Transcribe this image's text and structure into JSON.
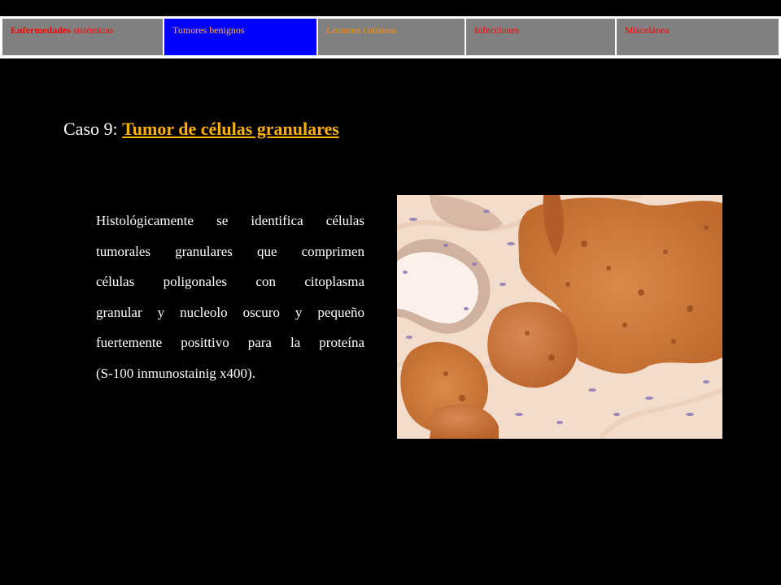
{
  "colors": {
    "background": "#000000",
    "nav_border": "#ffffff",
    "nav_cell_bg": "#808080",
    "nav_cell_active_bg": "#0000ff",
    "nav_text_red": "#ff0000",
    "nav_text_orange": "#ffb347",
    "title_text": "#ffffff",
    "title_link": "#ffb000",
    "body_text": "#ffffff"
  },
  "nav": {
    "items": [
      {
        "label_bold": "Enfermedades",
        "label_rest": " sistémicas",
        "color": "#ff0000",
        "active": false
      },
      {
        "label_bold": "",
        "label_rest": "Tumores benignos",
        "color": "#ffb347",
        "active": true
      },
      {
        "label_bold": "",
        "label_rest": "Lesiones cutáneas",
        "color": "#ff8c00",
        "active": false
      },
      {
        "label_bold": "",
        "label_rest": "Infecciones",
        "color": "#ff0000",
        "active": false
      },
      {
        "label_bold": "",
        "label_rest": "Miscelánea",
        "color": "#ff0000",
        "active": false
      }
    ]
  },
  "case": {
    "prefix": "Caso 9: ",
    "link": "Tumor de células granulares"
  },
  "description": {
    "lines": [
      "Histológicamente se identifica células",
      "tumorales granulares que comprimen",
      "células poligonales con citoplasma",
      "granular y nucleolo oscuro y pequeño",
      "fuertemente posittivo para la proteína",
      "(S-100 inmunostainig x400)."
    ]
  },
  "image": {
    "subject": "histology-micrograph-s100-stain",
    "colors": {
      "stroma": "#f3dccb",
      "tumor_light": "#d9874a",
      "tumor_dark": "#b8652b",
      "nuclei": "#7a3a1a",
      "lumen": "#fbf3ee",
      "blue_nuclei": "#8a78b8"
    }
  }
}
